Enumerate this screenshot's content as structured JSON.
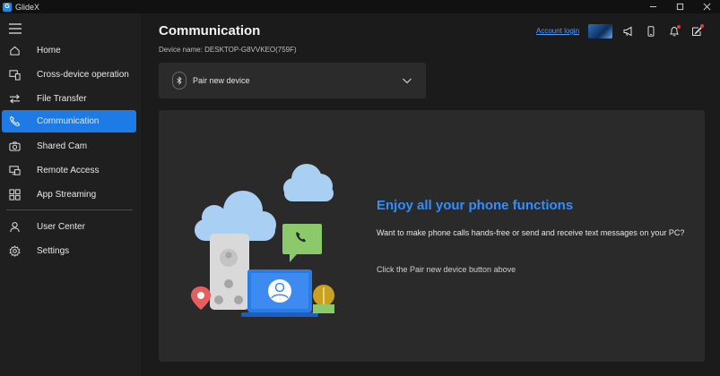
{
  "app": {
    "title": "GlideX"
  },
  "sidebar": {
    "items": [
      {
        "label": "Home",
        "icon": "home-icon"
      },
      {
        "label": "Cross-device operation",
        "icon": "cross-device-icon"
      },
      {
        "label": "File Transfer",
        "icon": "file-transfer-icon"
      },
      {
        "label": "Communication",
        "icon": "phone-icon",
        "active": true
      },
      {
        "label": "Shared Cam",
        "icon": "camera-icon"
      },
      {
        "label": "Remote Access",
        "icon": "remote-access-icon"
      },
      {
        "label": "App Streaming",
        "icon": "app-streaming-icon"
      },
      {
        "label": "User Center",
        "icon": "user-icon"
      },
      {
        "label": "Settings",
        "icon": "gear-icon"
      }
    ]
  },
  "header": {
    "title": "Communication",
    "device_name": "Device name: DESKTOP-G8VVKEO(759F)",
    "account_login": "Account login"
  },
  "pair": {
    "label": "Pair new device"
  },
  "main": {
    "heading": "Enjoy all your phone functions",
    "description": "Want to make phone calls hands-free or send and receive text messages on your PC?",
    "hint": "Click the Pair new device button above"
  },
  "colors": {
    "accent": "#1e7be6",
    "heading": "#2f8fff",
    "background": "#1b1b1b",
    "panel": "#2a2a2a"
  }
}
